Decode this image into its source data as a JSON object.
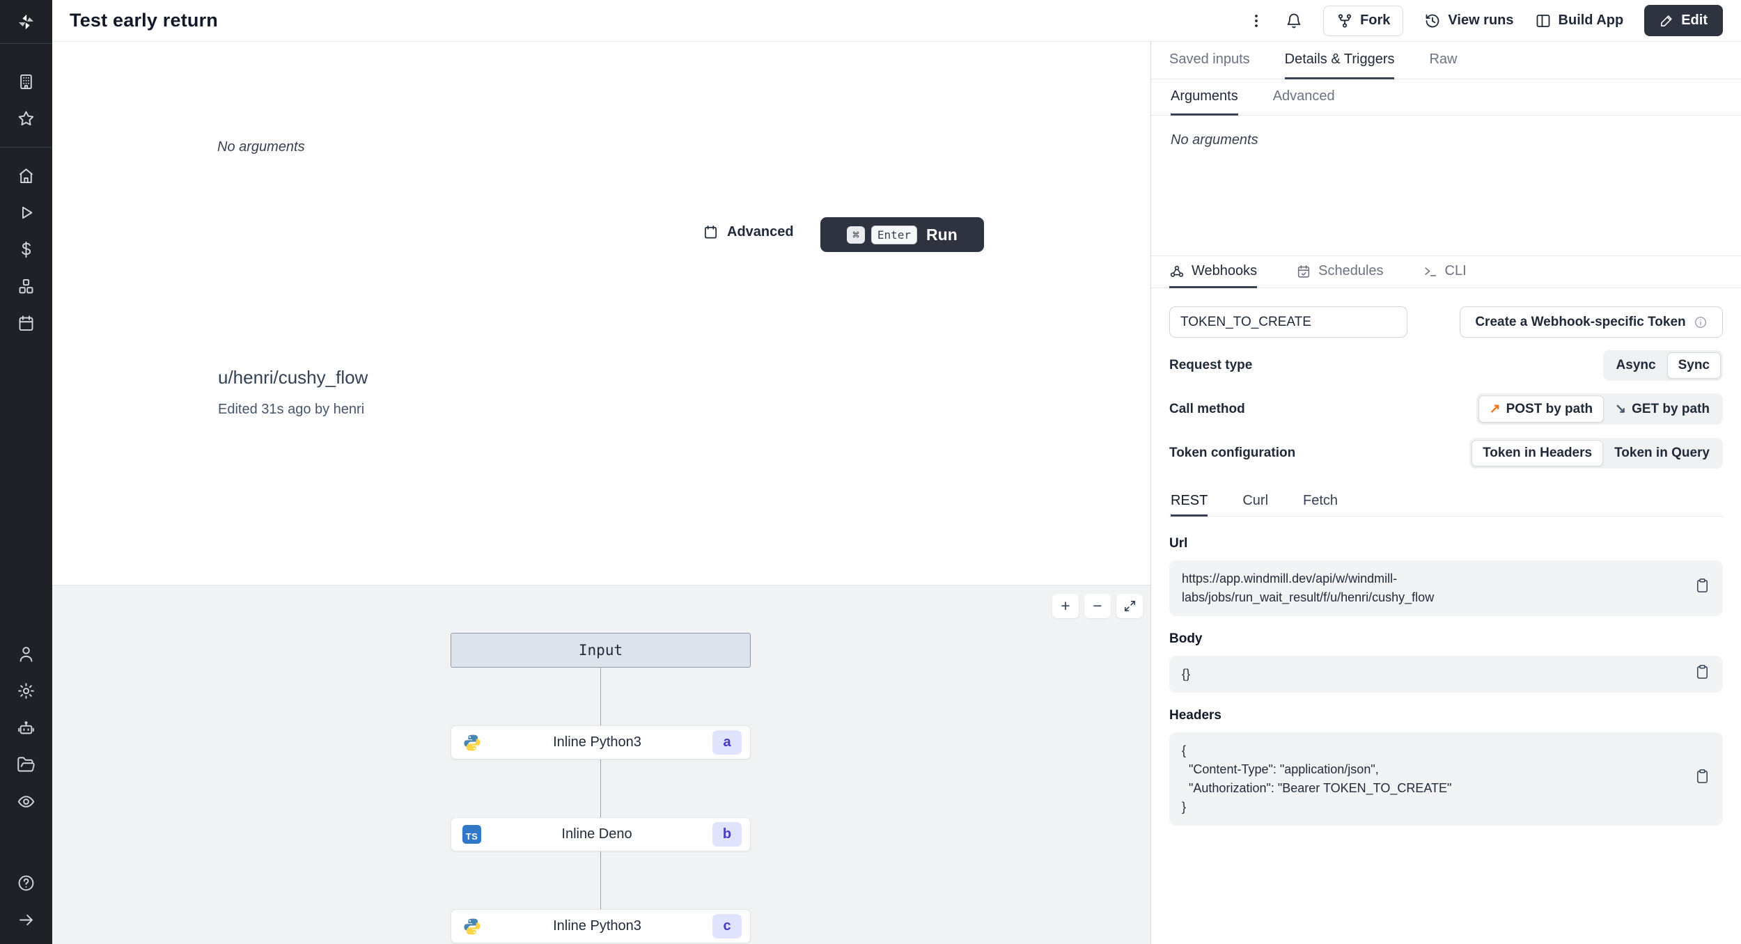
{
  "header": {
    "title": "Test early return",
    "fork": "Fork",
    "view_runs": "View runs",
    "build_app": "Build App",
    "edit": "Edit"
  },
  "main": {
    "no_arguments": "No arguments",
    "advanced": "Advanced",
    "run": {
      "cmd": "⌘",
      "enter": "Enter",
      "label": "Run"
    },
    "flow_path": "u/henri/cushy_flow",
    "edited": "Edited 31s ago by henri",
    "graph": {
      "input": "Input",
      "nodes": [
        {
          "label": "Inline Python3",
          "badge": "a",
          "lang": "python"
        },
        {
          "label": "Inline Deno",
          "badge": "b",
          "lang": "typescript"
        },
        {
          "label": "Inline Python3",
          "badge": "c",
          "lang": "python"
        }
      ],
      "zoom_in": "+",
      "zoom_out": "−",
      "ts_glyph": "TS"
    }
  },
  "panel": {
    "tabs": {
      "saved_inputs": "Saved inputs",
      "details": "Details & Triggers",
      "raw": "Raw"
    },
    "subtabs": {
      "arguments": "Arguments",
      "advanced": "Advanced"
    },
    "no_arguments": "No arguments",
    "triggers": {
      "webhooks": "Webhooks",
      "schedules": "Schedules",
      "cli": "CLI"
    },
    "token_value": "TOKEN_TO_CREATE",
    "create_token": "Create a Webhook-specific Token",
    "request_type": {
      "label": "Request type",
      "async": "Async",
      "sync": "Sync",
      "selected": "Sync"
    },
    "call_method": {
      "label": "Call method",
      "post": "POST by path",
      "get": "GET by path",
      "selected": "POST by path"
    },
    "token_config": {
      "label": "Token configuration",
      "headers": "Token in Headers",
      "query": "Token in Query",
      "selected": "Token in Headers"
    },
    "code_tabs": {
      "rest": "REST",
      "curl": "Curl",
      "fetch": "Fetch",
      "selected": "REST"
    },
    "url": {
      "label": "Url",
      "value": "https://app.windmill.dev/api/w/windmill-labs/jobs/run_wait_result/f/u/henri/cushy_flow"
    },
    "body": {
      "label": "Body",
      "value": "{}"
    },
    "headers": {
      "label": "Headers",
      "value": "{\n  \"Content-Type\": \"application/json\",\n  \"Authorization\": \"Bearer TOKEN_TO_CREATE\"\n}"
    }
  },
  "colors": {
    "accent_dark": "#2d3440",
    "badge": "#4338ca",
    "orange": "#f97316",
    "ts_blue": "#3178c6"
  }
}
